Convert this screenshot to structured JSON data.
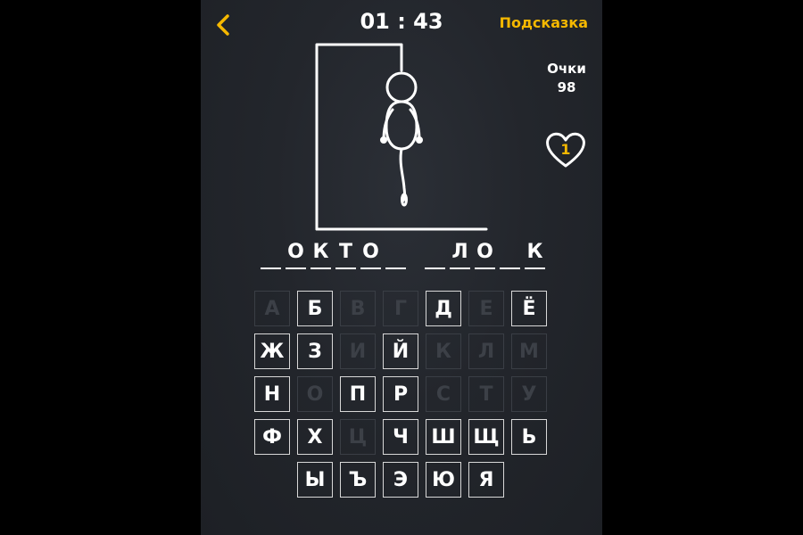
{
  "header": {
    "back_icon": "chevron-left-icon",
    "timer": "01 : 43",
    "hint_label": "Подсказка"
  },
  "score": {
    "label": "Очки",
    "value": "98"
  },
  "lives": {
    "icon": "heart-icon",
    "count": "1"
  },
  "colors": {
    "accent": "#f5b800",
    "background": "#23262c",
    "used_key": "#3c4047"
  },
  "word": {
    "first": [
      "",
      "О",
      "К",
      "Т",
      "О",
      ""
    ],
    "second": [
      "",
      "Л",
      "О",
      "",
      "К"
    ]
  },
  "keyboard": {
    "rows": [
      [
        {
          "letter": "А",
          "used": true
        },
        {
          "letter": "Б",
          "used": false
        },
        {
          "letter": "В",
          "used": true
        },
        {
          "letter": "Г",
          "used": true
        },
        {
          "letter": "Д",
          "used": false
        },
        {
          "letter": "Е",
          "used": true
        },
        {
          "letter": "Ё",
          "used": false
        }
      ],
      [
        {
          "letter": "Ж",
          "used": false
        },
        {
          "letter": "З",
          "used": false
        },
        {
          "letter": "И",
          "used": true
        },
        {
          "letter": "Й",
          "used": false
        },
        {
          "letter": "К",
          "used": true
        },
        {
          "letter": "Л",
          "used": true
        },
        {
          "letter": "М",
          "used": true
        }
      ],
      [
        {
          "letter": "Н",
          "used": false
        },
        {
          "letter": "О",
          "used": true
        },
        {
          "letter": "П",
          "used": false
        },
        {
          "letter": "Р",
          "used": false
        },
        {
          "letter": "С",
          "used": true
        },
        {
          "letter": "Т",
          "used": true
        },
        {
          "letter": "У",
          "used": true
        }
      ],
      [
        {
          "letter": "Ф",
          "used": false
        },
        {
          "letter": "Х",
          "used": false
        },
        {
          "letter": "Ц",
          "used": true
        },
        {
          "letter": "Ч",
          "used": false
        },
        {
          "letter": "Ш",
          "used": false
        },
        {
          "letter": "Щ",
          "used": false
        },
        {
          "letter": "Ь",
          "used": false
        }
      ],
      [
        {
          "letter": "Ы",
          "used": false
        },
        {
          "letter": "Ъ",
          "used": false
        },
        {
          "letter": "Э",
          "used": false
        },
        {
          "letter": "Ю",
          "used": false
        },
        {
          "letter": "Я",
          "used": false
        }
      ]
    ]
  }
}
